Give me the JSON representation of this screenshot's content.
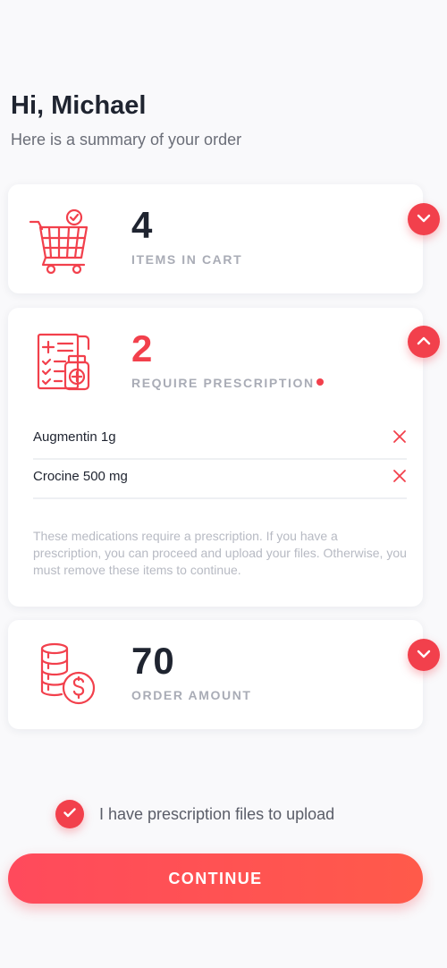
{
  "greeting": "Hi, Michael",
  "subtitle": "Here is a summary of your order",
  "cards": {
    "cart": {
      "value": "4",
      "label": "ITEMS IN CART",
      "icon": "shopping-cart-icon"
    },
    "prescription": {
      "value": "2",
      "label": "REQUIRE PRESCRIPTION",
      "icon": "prescription-document-icon",
      "items": [
        {
          "name": "Augmentin 1g"
        },
        {
          "name": "Crocine 500 mg"
        }
      ],
      "note": "These medications require a prescription. If you have a prescription, you can proceed and upload your files. Otherwise, you must remove these items to continue."
    },
    "amount": {
      "value": "70",
      "label": "ORDER AMOUNT",
      "icon": "coins-icon"
    }
  },
  "checkbox": {
    "label": "I have prescription files to upload",
    "checked": true
  },
  "cta": {
    "label": "CONTINUE"
  },
  "colors": {
    "accent": "#f2404c",
    "text_dark": "#1f2430",
    "caption": "#a9acb6"
  }
}
